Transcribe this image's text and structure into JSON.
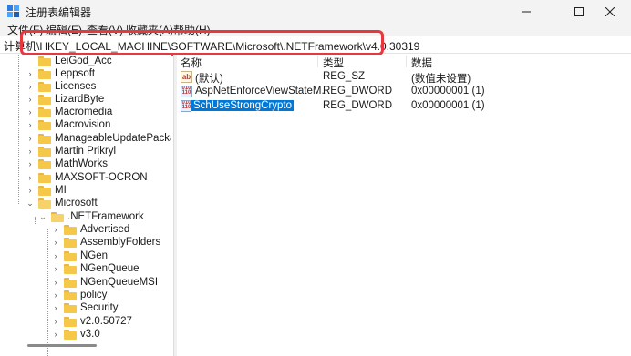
{
  "window": {
    "title": "注册表编辑器"
  },
  "menu": [
    "文件(F)",
    "编辑(E)",
    "查看(V)",
    "收藏夹(A)",
    "帮助(H)"
  ],
  "address": {
    "path": "计算机\\HKEY_LOCAL_MACHINE\\SOFTWARE\\Microsoft\\.NETFramework\\v4.0.30319"
  },
  "tree": {
    "items": [
      {
        "label": "LeiGod_Acc"
      },
      {
        "label": "Leppsoft"
      },
      {
        "label": "Licenses"
      },
      {
        "label": "LizardByte"
      },
      {
        "label": "Macromedia"
      },
      {
        "label": "Macrovision"
      },
      {
        "label": "ManageableUpdatePacka"
      },
      {
        "label": "Martin Prikryl"
      },
      {
        "label": "MathWorks"
      },
      {
        "label": "MAXSOFT-OCRON"
      },
      {
        "label": "MI"
      },
      {
        "label": "Microsoft"
      },
      {
        "label": ".NETFramework"
      },
      {
        "label": "Advertised"
      },
      {
        "label": "AssemblyFolders"
      },
      {
        "label": "NGen"
      },
      {
        "label": "NGenQueue"
      },
      {
        "label": "NGenQueueMSI"
      },
      {
        "label": "policy"
      },
      {
        "label": "Security"
      },
      {
        "label": "v2.0.50727"
      },
      {
        "label": "v3.0"
      }
    ]
  },
  "values_table": {
    "headers": {
      "name": "名称",
      "type": "类型",
      "data": "数据"
    },
    "rows": [
      {
        "name": "(默认)",
        "type": "REG_SZ",
        "data": "(数值未设置)",
        "icon": "string-value-icon"
      },
      {
        "name": "AspNetEnforceViewStateM...",
        "type": "REG_DWORD",
        "data": "0x00000001 (1)",
        "icon": "binary-value-icon"
      },
      {
        "name": "SchUseStrongCrypto",
        "type": "REG_DWORD",
        "data": "0x00000001 (1)",
        "icon": "binary-value-icon",
        "selected": true
      }
    ]
  },
  "colors": {
    "highlight_box": "#e8383f",
    "selection": "#0078d7"
  }
}
